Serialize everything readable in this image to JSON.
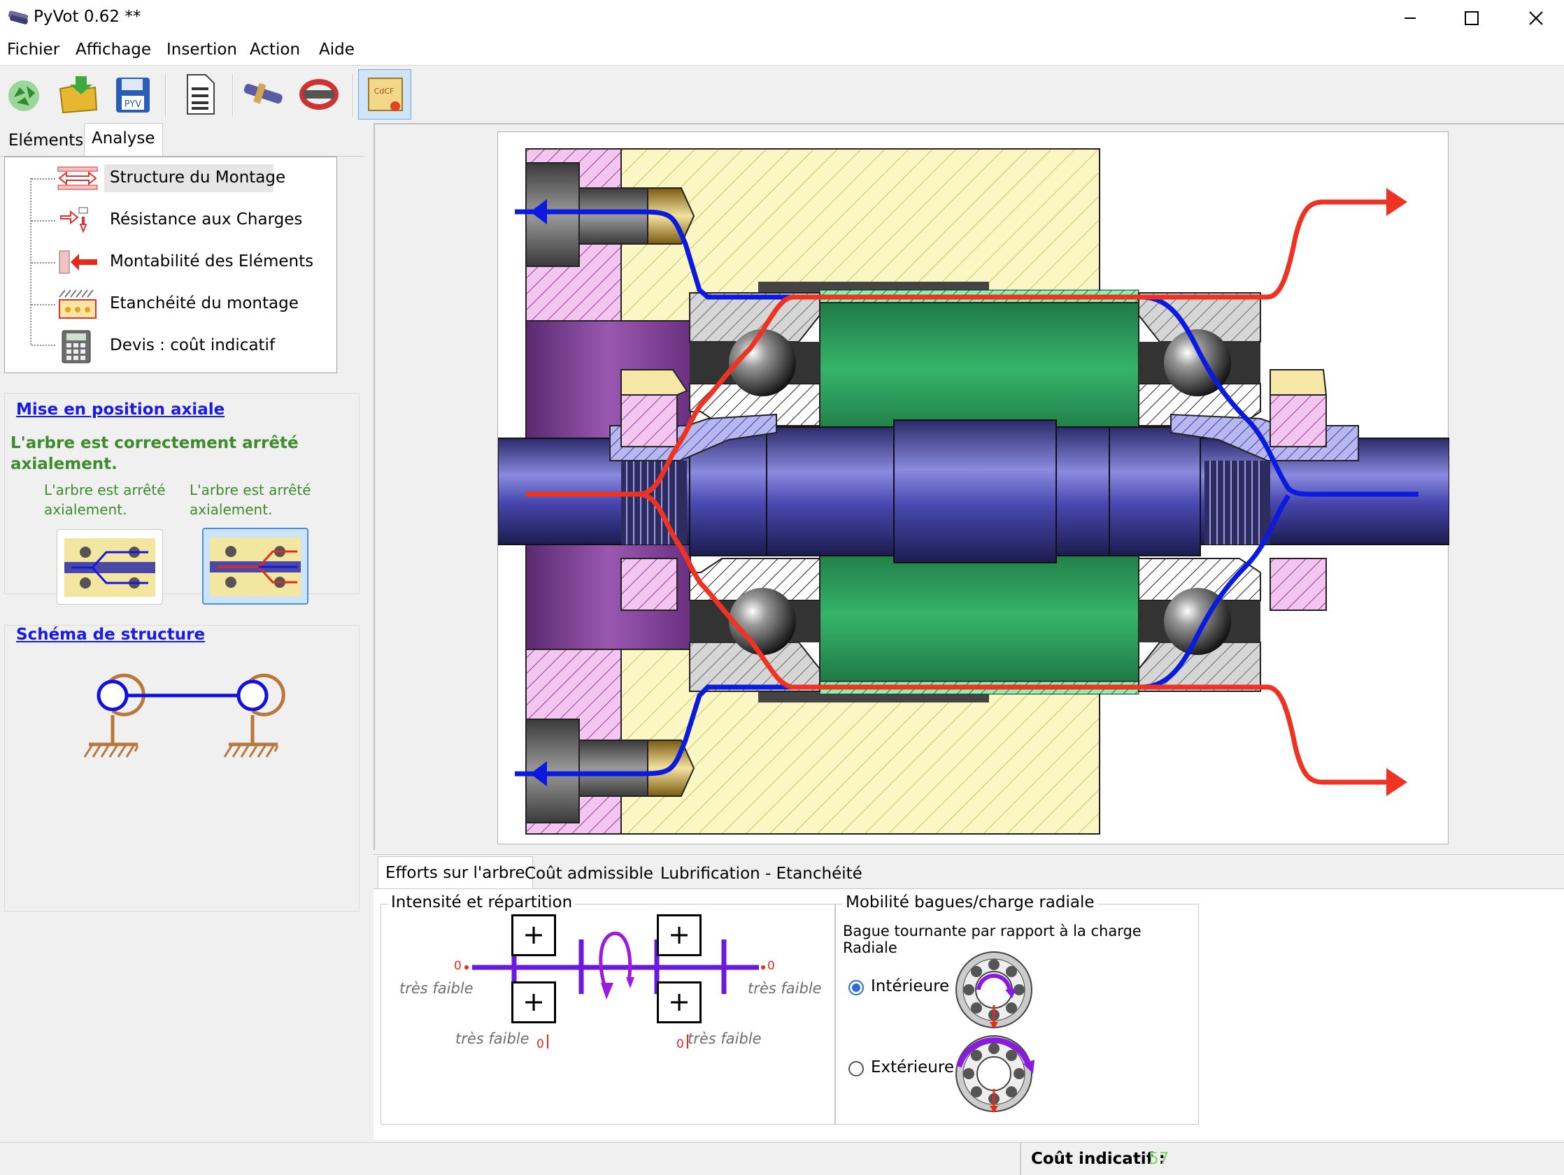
{
  "window": {
    "title": "PyVot 0.62 **",
    "minimize": "—",
    "maximize": "☐",
    "close": "✕"
  },
  "menu": [
    "Fichier",
    "Affichage",
    "Insertion",
    "Action",
    "Aide"
  ],
  "toolbar": {
    "buttons": [
      "recycle-icon",
      "open-folder-icon",
      "save-pyv-icon",
      "document-icon",
      "shaft-icon",
      "bearing-icon",
      "certificate-icon"
    ],
    "save_badge": "PYV",
    "certificate_badge": "CdCF"
  },
  "left_tabs": [
    "Eléments",
    "Analyse"
  ],
  "tree": [
    "Structure du Montage",
    "Résistance aux Charges",
    "Montabilité des Eléments",
    "Etanchéité du montage",
    "Devis : coût indicatif"
  ],
  "axial": {
    "title": "Mise en position axiale",
    "message": "L'arbre est correctement arrêté axialement.",
    "option1": "L'arbre est arrêté axialement.",
    "option2": "L'arbre est arrêté axialement."
  },
  "schema": {
    "title": "Schéma de structure"
  },
  "bottom_tabs": [
    "Efforts sur l'arbre",
    "Coût admissible",
    "Lubrification - Etanchéité"
  ],
  "efforts": {
    "group_title": "Intensité et répartition",
    "left_axial": "très faible",
    "right_axial": "très faible",
    "left_radial": "très faible",
    "right_radial": "très faible",
    "zero": "0",
    "plus": "+"
  },
  "mobilite": {
    "group_title": "Mobilité bagues/charge radiale",
    "subtitle": "Bague tournante par rapport à la charge Radiale",
    "option_inner": "Intérieure",
    "option_outer": "Extérieure",
    "selected": "Intérieure"
  },
  "status": {
    "label": "Coût indicatif :",
    "value": "57",
    "value_color": "#7cd96c"
  },
  "colors": {
    "red_flow": "#ee3322",
    "blue_flow": "#0a1adf",
    "link": "#1a1ae6",
    "ok_green": "#3c8c2c",
    "schema_blue": "#1010e0",
    "schema_orange": "#b8783c"
  }
}
